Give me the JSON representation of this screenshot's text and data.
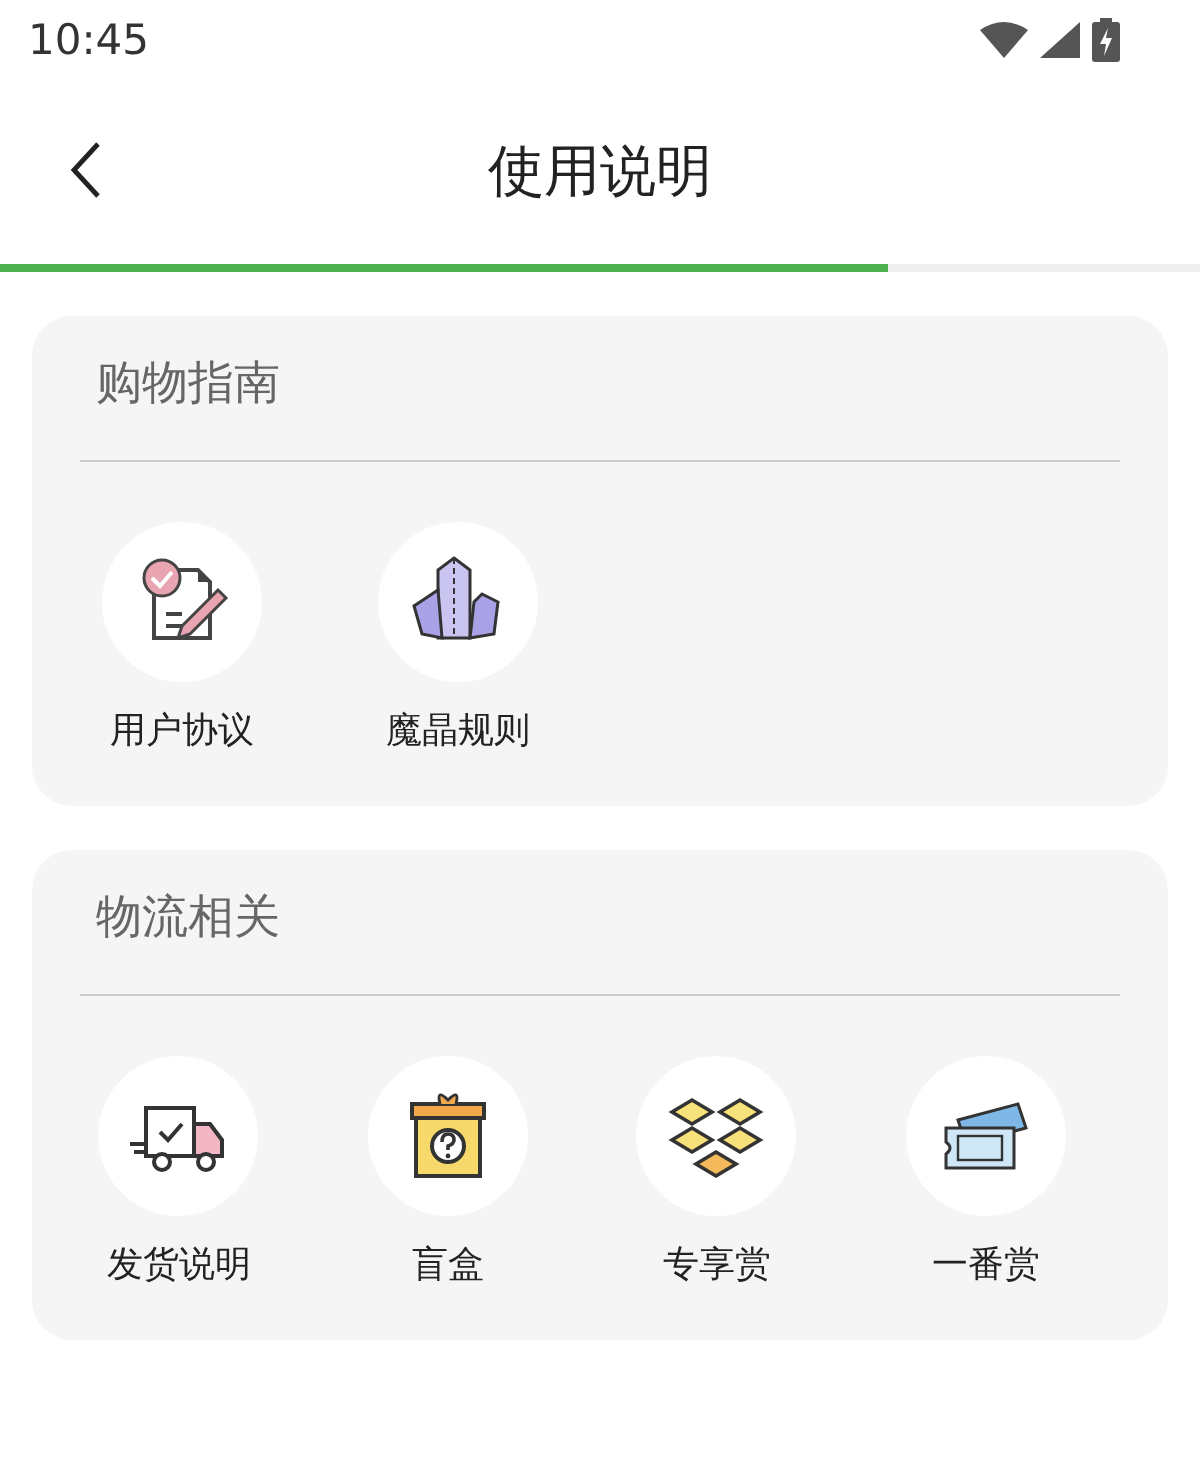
{
  "status_bar": {
    "time": "10:45"
  },
  "header": {
    "title": "使用说明"
  },
  "progress": {
    "level": 0.74
  },
  "sections": [
    {
      "title": "购物指南",
      "items": [
        {
          "kind": "agreement",
          "label": "用户协议"
        },
        {
          "kind": "crystal",
          "label": "魔晶规则"
        }
      ]
    },
    {
      "title": "物流相关",
      "items": [
        {
          "kind": "truck",
          "label": "发货说明"
        },
        {
          "kind": "giftbox",
          "label": "盲盒"
        },
        {
          "kind": "boxes",
          "label": "专享赏"
        },
        {
          "kind": "ticket",
          "label": "一番赏"
        }
      ]
    }
  ]
}
